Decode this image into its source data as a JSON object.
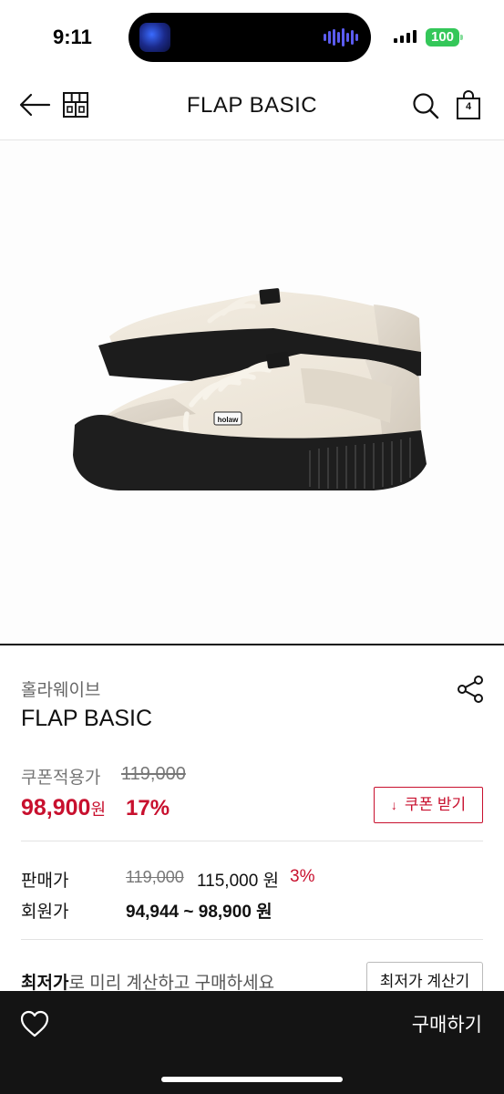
{
  "status_bar": {
    "time": "9:11",
    "battery": "100"
  },
  "header": {
    "title": "FLAP BASIC",
    "cart_count": "4"
  },
  "product": {
    "brand": "홀라웨이브",
    "name": "FLAP BASIC",
    "shoe_tag_text": "holaw",
    "coupon_price_label": "쿠폰적용가",
    "original_price": "119,000",
    "coupon_price": "98,900",
    "won_unit": "원",
    "coupon_discount": "17%",
    "coupon_button_label": "쿠폰 받기",
    "sale_price_label": "판매가",
    "sale_price_original": "119,000",
    "sale_price": "115,000 원",
    "sale_discount": "3%",
    "member_price_label": "회원가",
    "member_price": "94,944 ~ 98,900 원",
    "lowest_price_bold": "최저가",
    "lowest_price_text": "로 미리 계산하고 구매하세요",
    "calc_button_label": "최저가 계산기"
  },
  "bottom_bar": {
    "buy_label": "구매하기"
  },
  "colors": {
    "accent": "#c8102e",
    "bottom_bar": "#141414",
    "battery": "#34c759"
  },
  "icons": [
    "back-arrow-icon",
    "store-icon",
    "search-icon",
    "shopping-bag-icon",
    "share-icon",
    "heart-icon",
    "download-icon"
  ]
}
